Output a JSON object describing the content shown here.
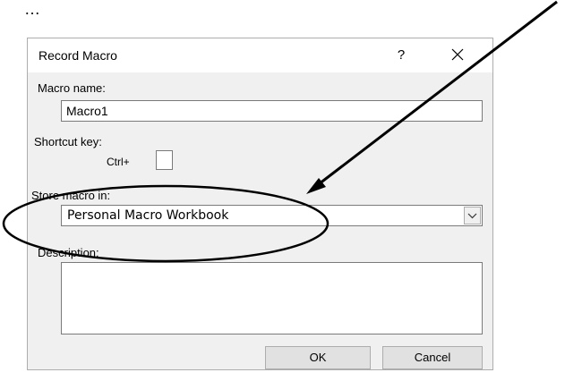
{
  "page": {
    "leading_text": "…"
  },
  "dialog": {
    "title": "Record Macro",
    "help_label": "?",
    "macro_name": {
      "label": "Macro name:",
      "value": "Macro1"
    },
    "shortcut": {
      "label": "Shortcut key:",
      "ctrl_label": "Ctrl+",
      "value": ""
    },
    "store_in": {
      "label": "Store macro in:",
      "selected": "Personal Macro Workbook"
    },
    "description": {
      "label": "Description:",
      "value": ""
    },
    "ok_label": "OK",
    "cancel_label": "Cancel"
  },
  "colors": {
    "dialog_bg": "#f0f0f0",
    "titlebar_bg": "#ffffff",
    "annotation": "#000000"
  },
  "icons": {
    "close": "close-icon",
    "dropdown": "chevron-down-icon"
  }
}
